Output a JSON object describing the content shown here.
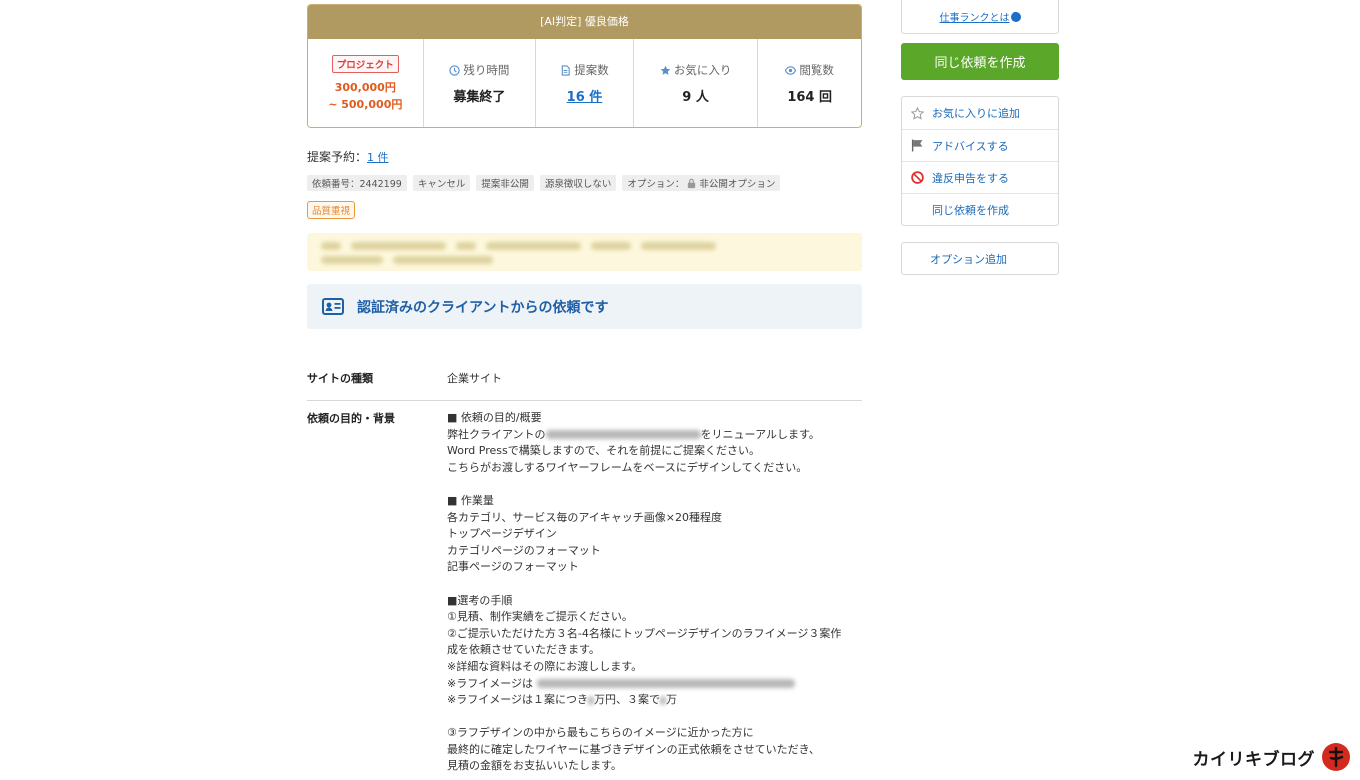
{
  "summary": {
    "header": "[AI判定] 優良価格",
    "project_tag": "プロジェクト",
    "price_line1": "300,000円",
    "price_line2": "~ 500,000円",
    "remaining_label": "残り時間",
    "remaining_value": "募集終了",
    "proposals_label": "提案数",
    "proposals_value": "16 件",
    "favorites_label": "お気に入り",
    "favorites_value": "9 人",
    "views_label": "閲覧数",
    "views_value": "164 回"
  },
  "reservation": {
    "label": "提案予約：",
    "link": "1 件"
  },
  "tags": {
    "request_no": "依頼番号：2442199",
    "cancel": "キャンセル",
    "private_proposal": "提案非公開",
    "no_withholding": "源泉徴収しない",
    "option_label": "オプション：",
    "option_value": "非公開オプション",
    "quality": "品質重視"
  },
  "verified": {
    "text": "認証済みのクライアントからの依頼です"
  },
  "details": {
    "site_type_label": "サイトの種類",
    "site_type_value": "企業サイト",
    "purpose_label": "依頼の目的・背景",
    "lines": {
      "l1": "■ 依頼の目的/概要",
      "l2a": "弊社クライアントの",
      "l2b": "をリニューアルします。",
      "l3": "Word Pressで構築しますので、それを前提にご提案ください。",
      "l4": "こちらがお渡しするワイヤーフレームをベースにデザインしてください。",
      "l5": "■ 作業量",
      "l6": "各カテゴリ、サービス毎のアイキャッチ画像×20種程度",
      "l7": "トップページデザイン",
      "l8": "カテゴリページのフォーマット",
      "l9": "記事ページのフォーマット",
      "l10": "■選考の手順",
      "l11": "①見積、制作実績をご提示ください。",
      "l12": "②ご提示いただけた方３名-4名様にトップページデザインのラフイメージ３案作",
      "l13": "成を依頼させていただきます。",
      "l14": "※詳細な資料はその際にお渡しします。",
      "l15": "※ラフイメージは",
      "l16a": "※ラフイメージは１案につき",
      "l16b": "万円、３案で",
      "l16c": "万",
      "l17": "③ラフデザインの中から最もこちらのイメージに近かった方に",
      "l18": "最終的に確定したワイヤーに基づきデザインの正式依頼をさせていただき、",
      "l19": "見積の金額をお支払いいたします。"
    }
  },
  "sidebar": {
    "rank_link": "仕事ランクとは",
    "create_button": "同じ依頼を作成",
    "menu": {
      "favorite": "お気に入りに追加",
      "advice": "アドバイスする",
      "report": "違反申告をする",
      "create_same": "同じ依頼を作成"
    },
    "option_add": "オプション追加"
  },
  "watermark": {
    "text": "カイリキブログ"
  },
  "colors": {
    "gold": "#b19a62",
    "green": "#5aa72a",
    "link": "#1a70c8",
    "price": "#e05a1c"
  }
}
